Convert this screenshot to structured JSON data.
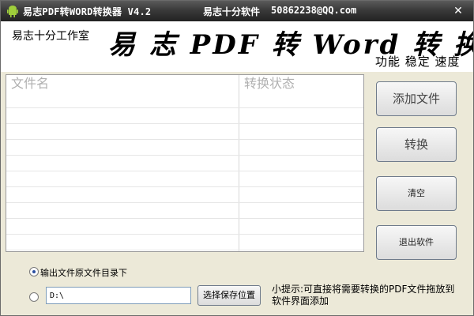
{
  "titlebar": {
    "title": "易志PDF转WORD转换器 V4.2",
    "author": "易志十分软件",
    "email": "50862238@QQ.com",
    "close_glyph": "✕"
  },
  "header": {
    "studio": "易志十分工作室",
    "banner_title": "易 志 PDF 转 Word 转 换 器",
    "slogan": "功能 稳定 速度"
  },
  "file_table": {
    "columns": [
      "文件名",
      "转换状态"
    ],
    "rows": []
  },
  "buttons": {
    "add_files": "添加文件",
    "convert": "转换",
    "clear": "清空",
    "exit": "退出软件"
  },
  "output": {
    "option_source_dir": "输出文件原文件目录下",
    "path_value": "D:\\",
    "browse_label": "选择保存位置",
    "selected_option": "source_dir"
  },
  "tip": "小提示:可直接将需要转换的PDF文件拖放到软件界面添加",
  "colors": {
    "titlebar": "#2e2e2e",
    "window_bg": "#ece9d8",
    "button_border": "#6f7b8b"
  },
  "icons": [
    "android-app-icon",
    "close-icon"
  ]
}
